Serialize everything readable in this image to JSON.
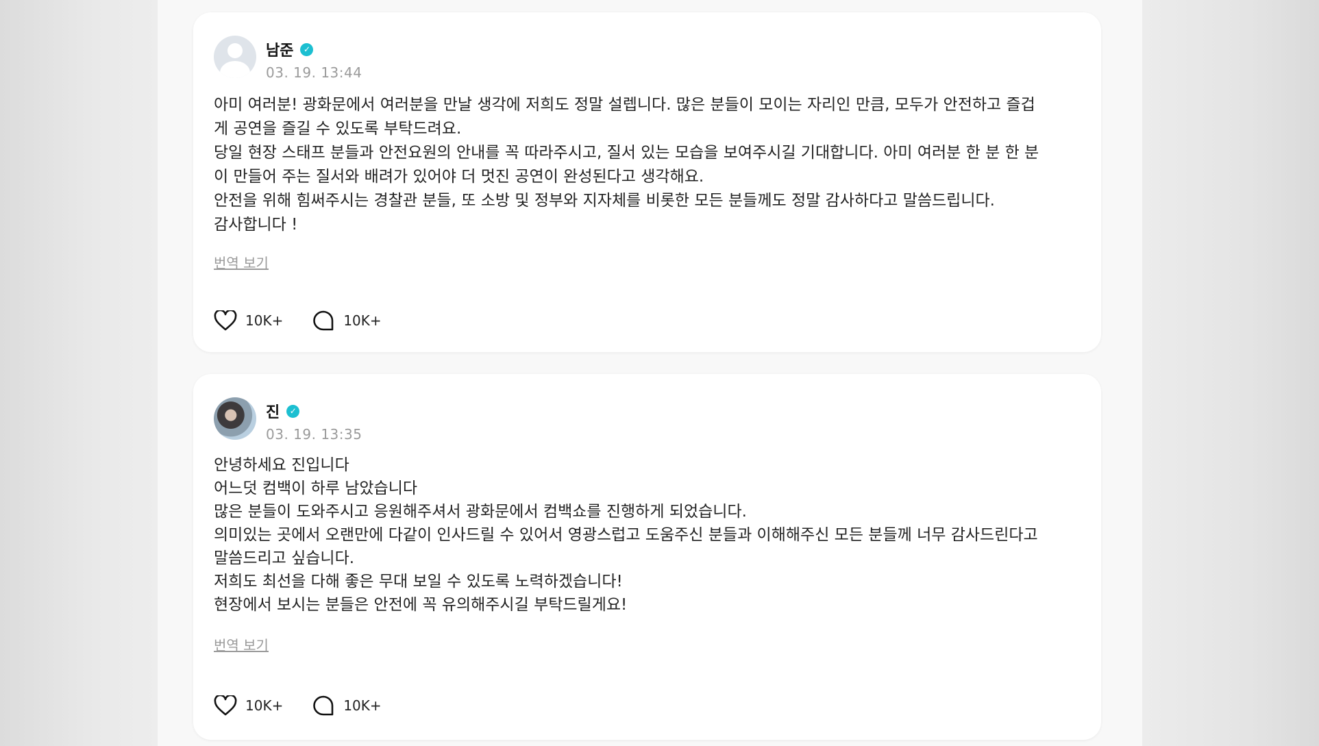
{
  "posts": [
    {
      "author": "남준",
      "timestamp": "03. 19. 13:44",
      "body_lines": [
        "아미 여러분! 광화문에서 여러분을 만날 생각에 저희도 정말 설렙니다. 많은 분들이 모이는 자리인 만큼, 모두가 안전하고 즐겁",
        "게 공연을 즐길 수 있도록 부탁드려요.",
        "당일 현장 스태프 분들과 안전요원의 안내를 꼭 따라주시고, 질서 있는 모습을 보여주시길 기대합니다. 아미 여러분 한 분 한 분",
        "이 만들어 주는 질서와 배려가 있어야 더 멋진 공연이 완성된다고 생각해요.",
        "안전을 위해 힘써주시는 경찰관 분들, 또 소방 및 정부와 지자체를 비롯한 모든 분들께도 정말 감사하다고 말씀드립니다.",
        "감사합니다 !"
      ],
      "translate_label": "번역 보기",
      "likes": "10K+",
      "comments": "10K+"
    },
    {
      "author": "진",
      "timestamp": "03. 19. 13:35",
      "body_lines": [
        "안녕하세요 진입니다",
        "어느덧 컴백이 하루 남았습니다",
        "많은 분들이 도와주시고 응원해주셔서 광화문에서 컴백쇼를 진행하게 되었습니다.",
        "의미있는 곳에서 오랜만에 다같이 인사드릴 수 있어서 영광스럽고 도움주신 분들과 이해해주신 모든 분들께 너무 감사드린다고",
        "말씀드리고 싶습니다.",
        "저희도 최선을 다해 좋은 무대 보일 수 있도록 노력하겠습니다!",
        "현장에서 보시는 분들은 안전에 꼭 유의해주시길 부탁드릴게요!"
      ],
      "translate_label": "번역 보기",
      "likes": "10K+",
      "comments": "10K+"
    }
  ],
  "colors": {
    "verified_badge": "#1cbfd1",
    "timestamp": "#9a9a9a",
    "text": "#222222"
  },
  "icons": {
    "verified": "verified-badge-icon",
    "like": "heart-icon",
    "comment": "comment-bubble-icon"
  }
}
